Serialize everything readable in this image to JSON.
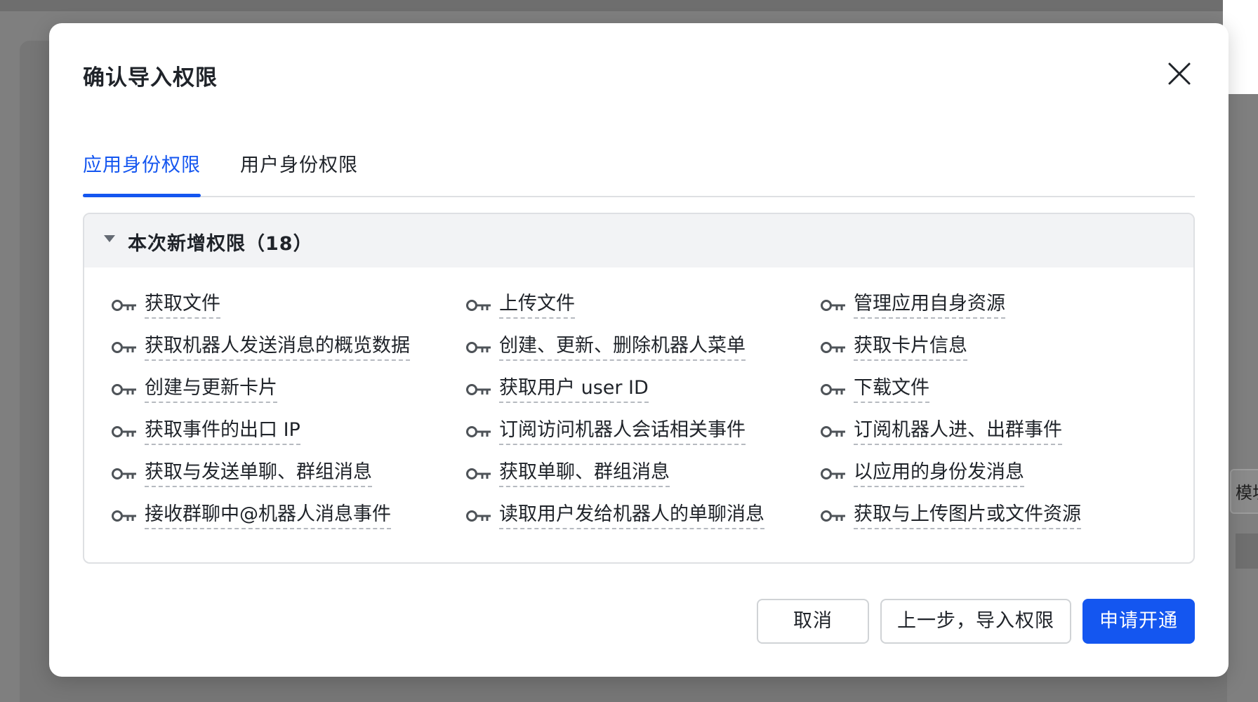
{
  "background": {
    "partial_button_text": "模块"
  },
  "modal": {
    "title": "确认导入权限",
    "close_icon": "close-icon",
    "tabs": [
      {
        "label": "应用身份权限",
        "active": true
      },
      {
        "label": "用户身份权限",
        "active": false
      }
    ],
    "section": {
      "title": "本次新增权限（18）",
      "expanded": true,
      "permissions": [
        "获取文件",
        "上传文件",
        "管理应用自身资源",
        "获取机器人发送消息的概览数据",
        "创建、更新、删除机器人菜单",
        "获取卡片信息",
        "创建与更新卡片",
        "获取用户 user ID",
        "下载文件",
        "获取事件的出口 IP",
        "订阅访问机器人会话相关事件",
        "订阅机器人进、出群事件",
        "获取与发送单聊、群组消息",
        "获取单聊、群组消息",
        "以应用的身份发消息",
        "接收群聊中@机器人消息事件",
        "读取用户发给机器人的单聊消息",
        "获取与上传图片或文件资源"
      ]
    },
    "buttons": {
      "cancel": "取消",
      "previous": "上一步，导入权限",
      "apply": "申请开通"
    }
  },
  "colors": {
    "accent": "#1456f0",
    "text": "#1f2329",
    "overlay": "#7f7f7f"
  }
}
